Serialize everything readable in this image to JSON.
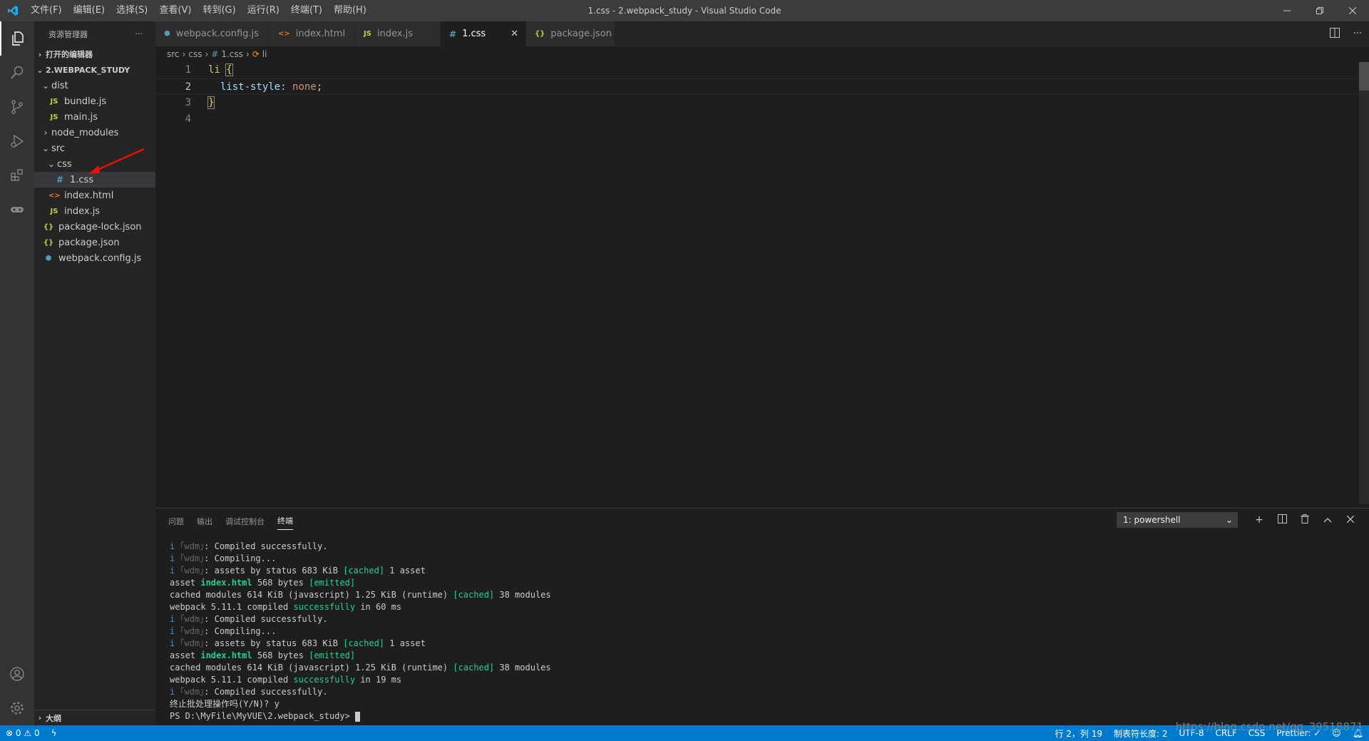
{
  "titlebar": {
    "menu": [
      "文件(F)",
      "编辑(E)",
      "选择(S)",
      "查看(V)",
      "转到(G)",
      "运行(R)",
      "终端(T)",
      "帮助(H)"
    ],
    "title": "1.css - 2.webpack_study - Visual Studio Code"
  },
  "sidebar": {
    "header": "资源管理器",
    "open_editors": "打开的编辑器",
    "project": "2.WEBPACK_STUDY",
    "items": [
      {
        "label": "dist",
        "type": "folder"
      },
      {
        "label": "bundle.js",
        "type": "js"
      },
      {
        "label": "main.js",
        "type": "js"
      },
      {
        "label": "node_modules",
        "type": "folder"
      },
      {
        "label": "src",
        "type": "folder"
      },
      {
        "label": "css",
        "type": "folder"
      },
      {
        "label": "1.css",
        "type": "css"
      },
      {
        "label": "index.html",
        "type": "html"
      },
      {
        "label": "index.js",
        "type": "js"
      },
      {
        "label": "package-lock.json",
        "type": "json"
      },
      {
        "label": "package.json",
        "type": "json"
      },
      {
        "label": "webpack.config.js",
        "type": "webpack"
      }
    ],
    "outline": "大纲"
  },
  "tabs": [
    {
      "label": "webpack.config.js",
      "icon": "webpack-icon"
    },
    {
      "label": "index.html",
      "icon": "html-icon"
    },
    {
      "label": "index.js",
      "icon": "js-icon"
    },
    {
      "label": "1.css",
      "icon": "css-icon"
    },
    {
      "label": "package.json",
      "icon": "json-icon"
    }
  ],
  "breadcrumb": [
    "src",
    "css",
    "1.css",
    "li"
  ],
  "code": {
    "line_numbers": [
      "1",
      "2",
      "3",
      "4"
    ],
    "l1_selector": "li",
    "l1_brace": "{",
    "l2_prop": "list-style",
    "l2_colon": ":",
    "l2_value": "none",
    "l2_semi": ";",
    "l3_brace": "}"
  },
  "panel": {
    "tabs": [
      "问题",
      "输出",
      "调试控制台",
      "终端"
    ],
    "terminal_select": "1: powershell"
  },
  "terminal": {
    "i": "i",
    "wdm": "｢wdm｣",
    "colon": ":",
    "compiled": " Compiled successfully.",
    "compiling": " Compiling...",
    "assets_a": " assets by status 683 KiB ",
    "cached": "[cached]",
    "assets_b": " 1 asset",
    "asset_a": "asset ",
    "index_html": "index.html",
    "asset_b": " 568 bytes ",
    "emitted": "[emitted]",
    "cached_mod_a": "cached modules 614 KiB (javascript) 1.25 KiB (runtime) ",
    "cached_mod_b": " 38 modules",
    "webpack_a": "webpack 5.11.1 compiled ",
    "successfully": "successfully",
    "webpack_b1": " in 60 ms",
    "webpack_b2": " in 19 ms",
    "terminate": "终止批处理操作吗(Y/N)? y",
    "prompt": "PS D:\\MyFile\\MyVUE\\2.webpack_study> "
  },
  "statusbar": {
    "errors": "0",
    "warnings": "0",
    "position": "行 2，列 19",
    "tab_size": "制表符长度: 2",
    "encoding": "UTF-8",
    "eol": "CRLF",
    "language": "CSS",
    "prettier": "Prettier: ✓"
  },
  "watermark": "https://blog.csdn.net/qq_39518871",
  "colors": {
    "accent": "#007acc",
    "js": "#cbcb41",
    "css": "#519aba",
    "html": "#e37933",
    "json": "#cbcb41",
    "arrow": "#e51400"
  }
}
